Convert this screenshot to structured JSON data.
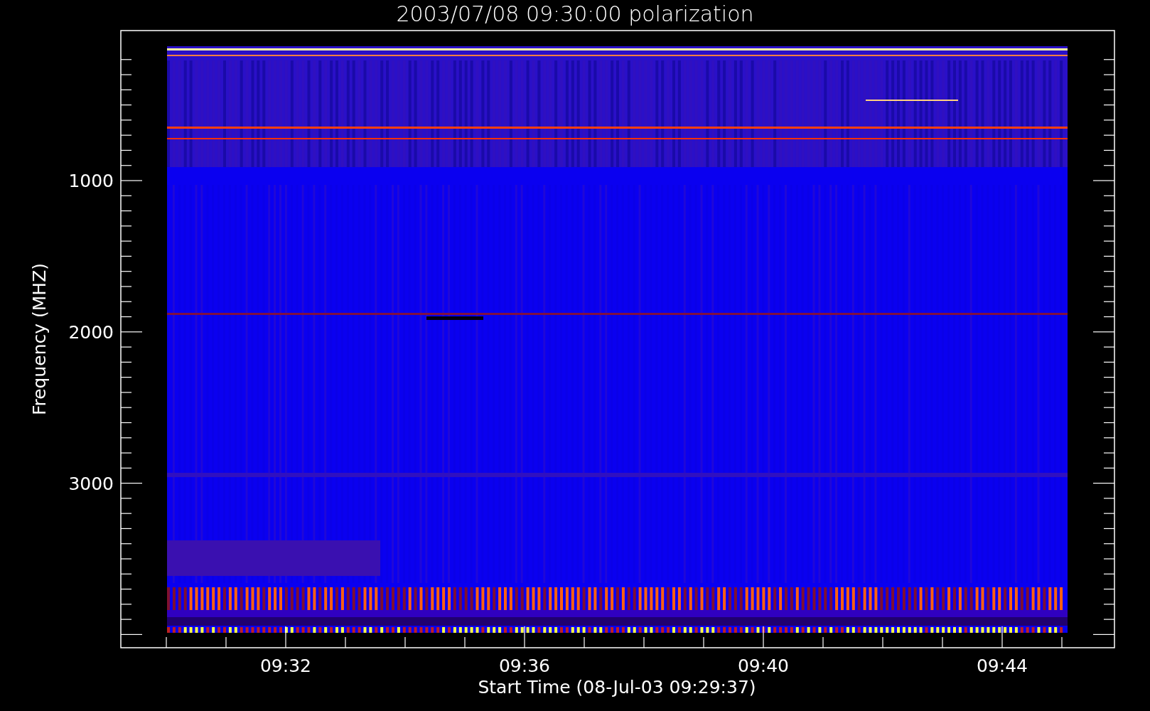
{
  "title": "2003/07/08 09:30:00 polarization",
  "y_axis": {
    "label": "Frequency (MHZ)",
    "ticks": [
      "1000",
      "2000",
      "3000"
    ]
  },
  "x_axis": {
    "label": "Start Time (08-Jul-03 09:29:37)",
    "ticks": [
      "09:32",
      "09:36",
      "09:40",
      "09:44"
    ]
  }
}
